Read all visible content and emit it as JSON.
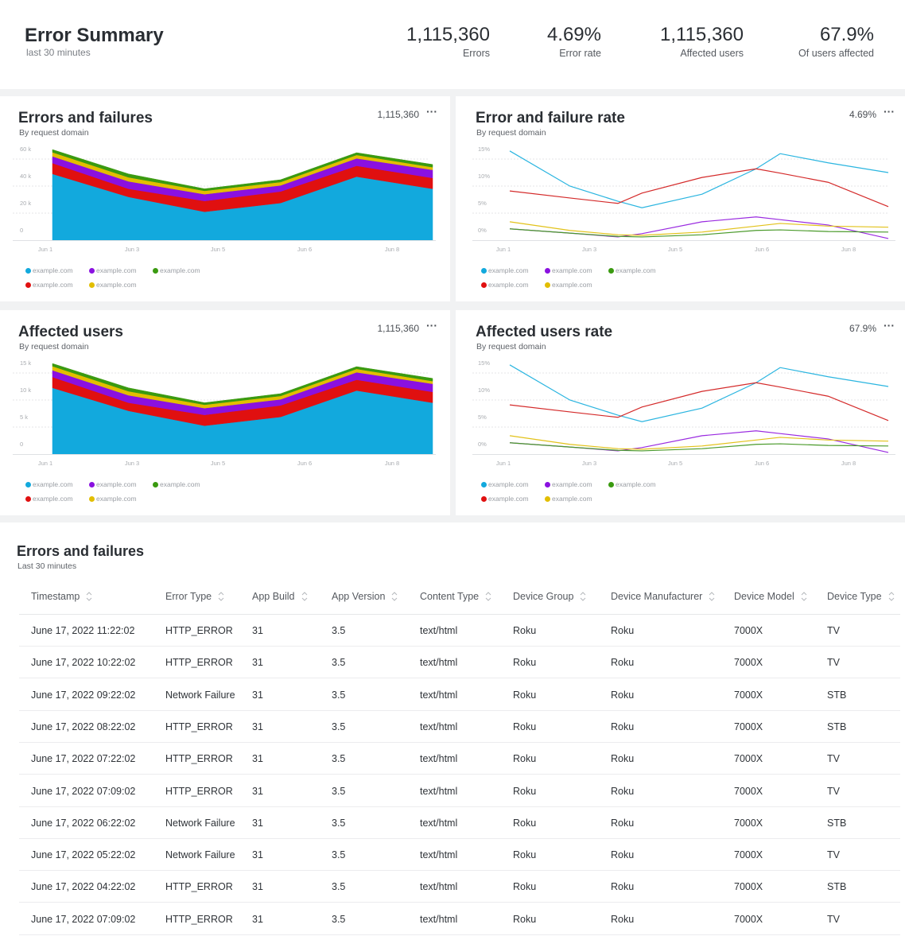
{
  "summary": {
    "title": "Error Summary",
    "subtitle": "last 30 minutes",
    "kpis": [
      {
        "value": "1,115,360",
        "label": "Errors"
      },
      {
        "value": "4.69%",
        "label": "Error rate"
      },
      {
        "value": "1,115,360",
        "label": "Affected users"
      },
      {
        "value": "67.9%",
        "label": "Of users affected"
      }
    ]
  },
  "legend": [
    {
      "label": "example.com",
      "color": "#12a9dd"
    },
    {
      "label": "example.com",
      "color": "#8a11e0"
    },
    {
      "label": "example.com",
      "color": "#3a9a10"
    },
    {
      "label": "example.com",
      "color": "#e01010"
    },
    {
      "label": "example.com",
      "color": "#e2be00"
    }
  ],
  "cards": [
    {
      "title": "Errors and failures",
      "subtitle": "By request domain",
      "total": "1,115,360",
      "more": "···"
    },
    {
      "title": "Error and failure rate",
      "subtitle": "By request domain",
      "total": "4.69%",
      "more": "···"
    },
    {
      "title": "Affected users",
      "subtitle": "By request domain",
      "total": "1,115,360",
      "more": "···"
    },
    {
      "title": "Affected users rate",
      "subtitle": "By request domain",
      "total": "67.9%",
      "more": "···"
    }
  ],
  "chart_data": [
    {
      "type": "area",
      "stacked": true,
      "title": "Errors and failures",
      "subtitle": "By request domain",
      "x_ticks": [
        "Jun 1",
        "Jun 3",
        "Jun 5",
        "Jun 6",
        "Jun 8"
      ],
      "y_ticks": [
        "0",
        "20 k",
        "40 k",
        "60 k"
      ],
      "ylim": [
        0,
        60000
      ],
      "x": [
        0,
        1,
        2,
        3,
        4,
        5
      ],
      "series": [
        {
          "name": "example.com",
          "color": "#12a9dd",
          "values": [
            49000,
            32000,
            21000,
            27500,
            47000,
            38000
          ]
        },
        {
          "name": "example.com",
          "color": "#e01010",
          "values": [
            8000,
            6000,
            8000,
            8500,
            8000,
            8000
          ]
        },
        {
          "name": "example.com",
          "color": "#8a11e0",
          "values": [
            5000,
            5500,
            5000,
            4500,
            5500,
            6000
          ]
        },
        {
          "name": "example.com",
          "color": "#e2be00",
          "values": [
            3000,
            3000,
            2500,
            2500,
            2500,
            2000
          ]
        },
        {
          "name": "example.com",
          "color": "#3a9a10",
          "values": [
            2000,
            2500,
            1500,
            1700,
            1700,
            2000
          ]
        }
      ]
    },
    {
      "type": "line",
      "title": "Error and failure rate",
      "subtitle": "By request domain",
      "x_ticks": [
        "Jun 1",
        "Jun 3",
        "Jun 5",
        "Jun 6",
        "Jun 8"
      ],
      "y_ticks": [
        "0%",
        "5%",
        "10%",
        "15%"
      ],
      "ylim": [
        0,
        15
      ],
      "x": [
        0,
        1,
        1.8,
        2.2,
        3.2,
        4.1,
        4.5,
        5.3,
        6.3
      ],
      "series": [
        {
          "name": "example.com",
          "color": "#2bb5e0",
          "values": [
            16.5,
            10,
            7.2,
            6,
            8.5,
            13.2,
            16,
            14.3,
            12.5
          ]
        },
        {
          "name": "example.com",
          "color": "#d42a2a",
          "values": [
            9.1,
            7.8,
            6.8,
            8.7,
            11.6,
            13.2,
            12.4,
            10.7,
            6.2
          ]
        },
        {
          "name": "example.com",
          "color": "#9a2be0",
          "values": [
            2.1,
            1.3,
            0.6,
            1.2,
            3.4,
            4.3,
            3.8,
            2.8,
            0.3
          ]
        },
        {
          "name": "example.com",
          "color": "#e2c21a",
          "values": [
            3.4,
            1.8,
            1.0,
            0.9,
            1.5,
            2.6,
            3.1,
            2.6,
            2.4
          ]
        },
        {
          "name": "example.com",
          "color": "#4a9a2a",
          "values": [
            2.1,
            1.3,
            0.7,
            0.6,
            1.0,
            1.8,
            1.9,
            1.6,
            1.5
          ]
        }
      ]
    },
    {
      "type": "area",
      "stacked": true,
      "title": "Affected users",
      "subtitle": "By request domain",
      "x_ticks": [
        "Jun 1",
        "Jun 3",
        "Jun 5",
        "Jun 6",
        "Jun 8"
      ],
      "y_ticks": [
        "0",
        "5 k",
        "10 k",
        "15 k"
      ],
      "ylim": [
        0,
        15000
      ],
      "x": [
        0,
        1,
        2,
        3,
        4,
        5
      ],
      "series": [
        {
          "name": "example.com",
          "color": "#12a9dd",
          "values": [
            12250,
            8000,
            5250,
            6875,
            11750,
            9500
          ]
        },
        {
          "name": "example.com",
          "color": "#e01010",
          "values": [
            2000,
            1500,
            2000,
            2125,
            2000,
            2000
          ]
        },
        {
          "name": "example.com",
          "color": "#8a11e0",
          "values": [
            1250,
            1375,
            1250,
            1125,
            1375,
            1500
          ]
        },
        {
          "name": "example.com",
          "color": "#e2be00",
          "values": [
            750,
            750,
            625,
            625,
            625,
            500
          ]
        },
        {
          "name": "example.com",
          "color": "#3a9a10",
          "values": [
            500,
            625,
            375,
            425,
            425,
            500
          ]
        }
      ]
    },
    {
      "type": "line",
      "title": "Affected users rate",
      "subtitle": "By request domain",
      "x_ticks": [
        "Jun 1",
        "Jun 3",
        "Jun 5",
        "Jun 6",
        "Jun 8"
      ],
      "y_ticks": [
        "0%",
        "5%",
        "10%",
        "15%"
      ],
      "ylim": [
        0,
        15
      ],
      "x": [
        0,
        1,
        1.8,
        2.2,
        3.2,
        4.1,
        4.5,
        5.3,
        6.3
      ],
      "series": [
        {
          "name": "example.com",
          "color": "#2bb5e0",
          "values": [
            16.5,
            10,
            7.2,
            6,
            8.5,
            13.2,
            16,
            14.3,
            12.5
          ]
        },
        {
          "name": "example.com",
          "color": "#d42a2a",
          "values": [
            9.1,
            7.8,
            6.8,
            8.7,
            11.6,
            13.2,
            12.4,
            10.7,
            6.2
          ]
        },
        {
          "name": "example.com",
          "color": "#9a2be0",
          "values": [
            2.1,
            1.3,
            0.6,
            1.2,
            3.4,
            4.3,
            3.8,
            2.8,
            0.3
          ]
        },
        {
          "name": "example.com",
          "color": "#e2c21a",
          "values": [
            3.4,
            1.8,
            1.0,
            0.9,
            1.5,
            2.6,
            3.1,
            2.6,
            2.4
          ]
        },
        {
          "name": "example.com",
          "color": "#4a9a2a",
          "values": [
            2.1,
            1.3,
            0.7,
            0.6,
            1.0,
            1.8,
            1.9,
            1.6,
            1.5
          ]
        }
      ]
    }
  ],
  "table": {
    "title": "Errors and failures",
    "subtitle": "Last 30 minutes",
    "columns": [
      "Timestamp",
      "Error Type",
      "App Build",
      "App Version",
      "Content Type",
      "Device Group",
      "Device Manufacturer",
      "Device Model",
      "Device Type"
    ],
    "rows": [
      [
        "June 17, 2022 11:22:02",
        "HTTP_ERROR",
        "31",
        "3.5",
        "text/html",
        "Roku",
        "Roku",
        "7000X",
        "TV"
      ],
      [
        "June 17, 2022 10:22:02",
        "HTTP_ERROR",
        "31",
        "3.5",
        "text/html",
        "Roku",
        "Roku",
        "7000X",
        "TV"
      ],
      [
        "June 17, 2022 09:22:02",
        "Network Failure",
        "31",
        "3.5",
        "text/html",
        "Roku",
        "Roku",
        "7000X",
        "STB"
      ],
      [
        "June 17, 2022 08:22:02",
        "HTTP_ERROR",
        "31",
        "3.5",
        "text/html",
        "Roku",
        "Roku",
        "7000X",
        "STB"
      ],
      [
        "June 17, 2022 07:22:02",
        "HTTP_ERROR",
        "31",
        "3.5",
        "text/html",
        "Roku",
        "Roku",
        "7000X",
        "TV"
      ],
      [
        "June 17, 2022 07:09:02",
        "HTTP_ERROR",
        "31",
        "3.5",
        "text/html",
        "Roku",
        "Roku",
        "7000X",
        "TV"
      ],
      [
        "June 17, 2022 06:22:02",
        "Network Failure",
        "31",
        "3.5",
        "text/html",
        "Roku",
        "Roku",
        "7000X",
        "STB"
      ],
      [
        "June 17, 2022 05:22:02",
        "Network Failure",
        "31",
        "3.5",
        "text/html",
        "Roku",
        "Roku",
        "7000X",
        "TV"
      ],
      [
        "June 17, 2022 04:22:02",
        "HTTP_ERROR",
        "31",
        "3.5",
        "text/html",
        "Roku",
        "Roku",
        "7000X",
        "STB"
      ],
      [
        "June 17, 2022 07:09:02",
        "HTTP_ERROR",
        "31",
        "3.5",
        "text/html",
        "Roku",
        "Roku",
        "7000X",
        "TV"
      ]
    ]
  }
}
